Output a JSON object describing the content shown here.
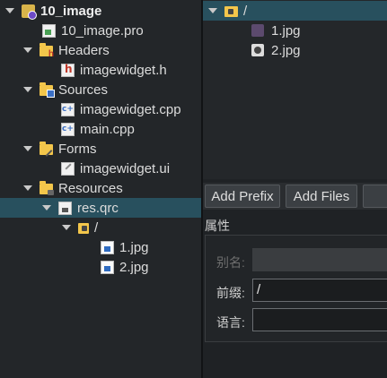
{
  "tree": {
    "items": [
      {
        "label": "10_image"
      },
      {
        "label": "10_image.pro"
      },
      {
        "label": "Headers"
      },
      {
        "label": "imagewidget.h"
      },
      {
        "label": "Sources"
      },
      {
        "label": "imagewidget.cpp"
      },
      {
        "label": "main.cpp"
      },
      {
        "label": "Forms"
      },
      {
        "label": "imagewidget.ui"
      },
      {
        "label": "Resources"
      },
      {
        "label": "res.qrc"
      },
      {
        "label": "/"
      },
      {
        "label": "1.jpg"
      },
      {
        "label": "2.jpg"
      }
    ]
  },
  "resource_view": {
    "prefix": "/",
    "files": [
      {
        "label": "1.jpg"
      },
      {
        "label": "2.jpg"
      }
    ]
  },
  "buttons": {
    "add_prefix": "Add Prefix",
    "add_files": "Add Files"
  },
  "properties": {
    "title": "属性",
    "alias_label": "别名:",
    "alias_value": "",
    "prefix_label": "前缀:",
    "prefix_value": "/",
    "language_label": "语言:",
    "language_value": ""
  }
}
